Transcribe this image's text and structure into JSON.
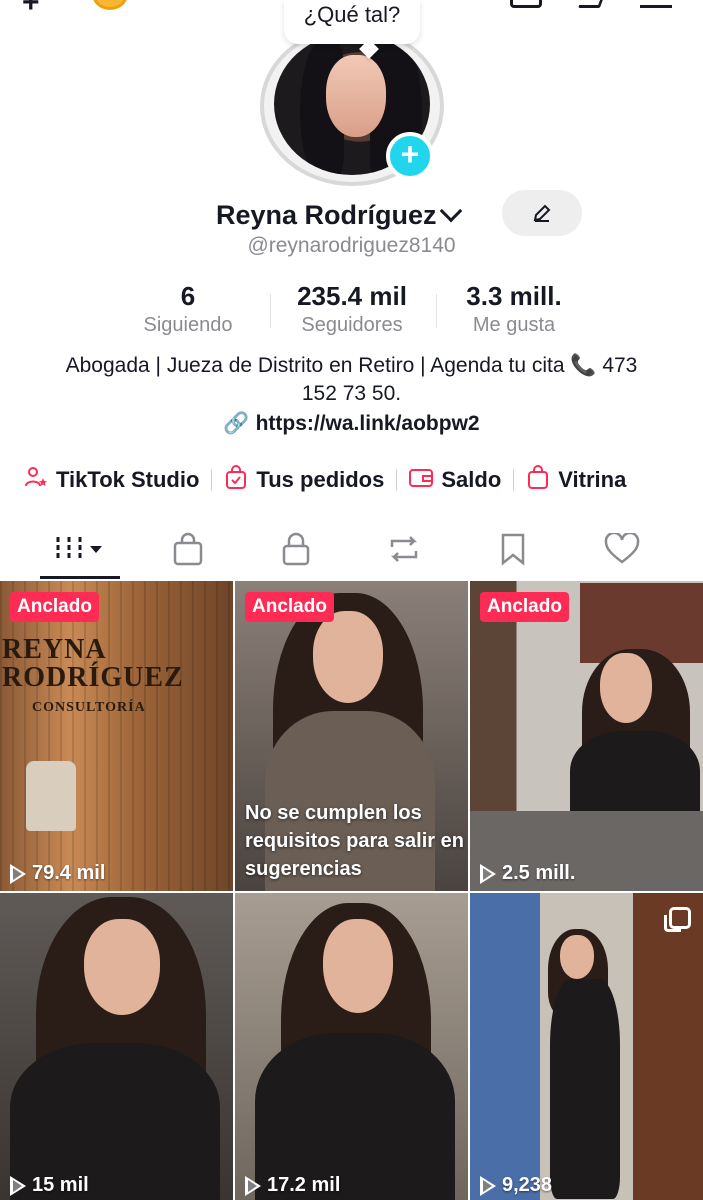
{
  "speech_bubble": "¿Qué tal?",
  "profile": {
    "name": "Reyna Rodríguez",
    "handle": "@reynarodriguez8140",
    "bio": "Abogada | Jueza de Distrito en Retiro | Agenda tu cita 📞 473 152 73 50.",
    "link": "https://wa.link/aobpw2"
  },
  "stats": [
    {
      "value": "6",
      "label": "Siguiendo"
    },
    {
      "value": "235.4 mil",
      "label": "Seguidores"
    },
    {
      "value": "3.3 mill.",
      "label": "Me gusta"
    }
  ],
  "tools": [
    {
      "label": "TikTok Studio",
      "icon": "user-star-icon"
    },
    {
      "label": "Tus pedidos",
      "icon": "order-bag-icon"
    },
    {
      "label": "Saldo",
      "icon": "wallet-icon"
    },
    {
      "label": "Vitrina",
      "icon": "shopping-bag-icon"
    }
  ],
  "tabs": [
    {
      "icon": "videos-grid-icon",
      "active": true
    },
    {
      "icon": "shop-bag-icon"
    },
    {
      "icon": "lock-icon"
    },
    {
      "icon": "repost-icon"
    },
    {
      "icon": "bookmark-icon"
    },
    {
      "icon": "heart-icon"
    }
  ],
  "videos": [
    {
      "pinned_label": "Anclado",
      "views": "79.4 mil",
      "sign_line1": "REYNA",
      "sign_line2": "RODRÍGUEZ",
      "sign_line3": "CONSULTORÍA"
    },
    {
      "pinned_label": "Anclado",
      "caption": "No se cumplen los requisitos para salir en sugerencias"
    },
    {
      "pinned_label": "Anclado",
      "views": "2.5 mill."
    },
    {
      "views": "15 mil"
    },
    {
      "views": "17.2 mil"
    },
    {
      "views": "9,238",
      "multi_image": true
    }
  ],
  "colors": {
    "accent": "#fe2c55",
    "avatar_add": "#20d5ec",
    "text_primary": "#161823",
    "text_secondary": "#8a8b91"
  }
}
